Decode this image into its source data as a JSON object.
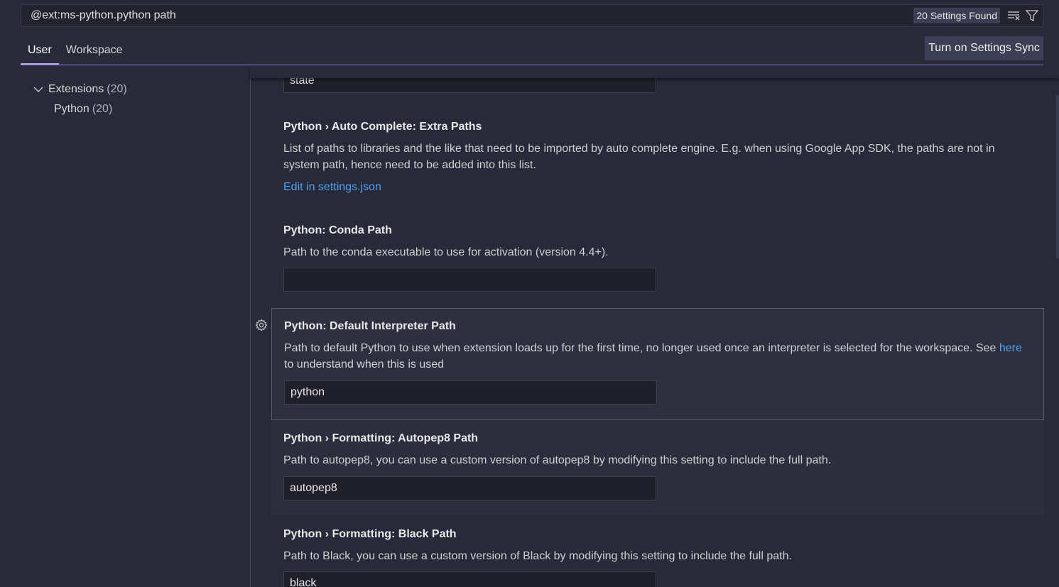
{
  "search": {
    "value": "@ext:ms-python.python path",
    "count_label": "20 Settings Found",
    "clear_icon": "clear-filter-icon",
    "filter_icon": "filter-icon"
  },
  "tabs": [
    {
      "label": "User",
      "active": true
    },
    {
      "label": "Workspace",
      "active": false
    }
  ],
  "sync_button": "Turn on Settings Sync",
  "toc": {
    "group": {
      "label": "Extensions",
      "count": "(20)"
    },
    "child": {
      "label": "Python",
      "count": "(20)"
    }
  },
  "settings": {
    "prev_input_value": "state",
    "extra_paths": {
      "category": "Python › Auto Complete: ",
      "name": "Extra Paths",
      "desc": "List of paths to libraries and the like that need to be imported by auto complete engine. E.g. when using Google App SDK, the paths are not in system path, hence need to be added into this list.",
      "link": "Edit in settings.json"
    },
    "conda_path": {
      "category": "Python: ",
      "name": "Conda Path",
      "desc": "Path to the conda executable to use for activation (version 4.4+).",
      "value": ""
    },
    "default_interpreter": {
      "category": "Python: ",
      "name": "Default Interpreter Path",
      "desc": "Path to default Python to use when extension loads up for the first time, no longer used once an interpreter is selected for the workspace. See ",
      "link": "here",
      "desc_after": " to understand when this is used",
      "value": "python"
    },
    "autopep8": {
      "category": "Python › Formatting: ",
      "name": "Autopep8 Path",
      "desc": "Path to autopep8, you can use a custom version of autopep8 by modifying this setting to include the full path.",
      "value": "autopep8"
    },
    "black": {
      "category": "Python › Formatting: ",
      "name": "Black Path",
      "desc": "Path to Black, you can use a custom version of Black by modifying this setting to include the full path.",
      "value": "black"
    }
  },
  "colors": {
    "background": "#282a3a",
    "accent": "#8c7fd1",
    "link": "#4ea1f0"
  }
}
